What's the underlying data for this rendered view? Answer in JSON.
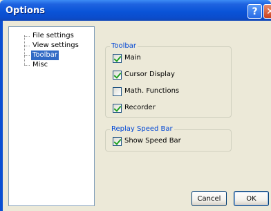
{
  "window": {
    "title": "Options",
    "help_glyph": "?",
    "close_glyph": "✕"
  },
  "tree": {
    "items": [
      {
        "label": "File settings",
        "selected": false
      },
      {
        "label": "View settings",
        "selected": false
      },
      {
        "label": "Toolbar",
        "selected": true
      },
      {
        "label": "Misc",
        "selected": false
      }
    ]
  },
  "toolbar_group": {
    "title": "Toolbar",
    "options": [
      {
        "label": "Main",
        "checked": true
      },
      {
        "label": "Cursor Display",
        "checked": true
      },
      {
        "label": "Math. Functions",
        "checked": false
      },
      {
        "label": "Recorder",
        "checked": true
      }
    ]
  },
  "speed_group": {
    "title": "Replay Speed Bar",
    "options": [
      {
        "label": "Show Speed Bar",
        "checked": true
      }
    ]
  },
  "buttons": {
    "cancel": "Cancel",
    "ok": "OK"
  }
}
